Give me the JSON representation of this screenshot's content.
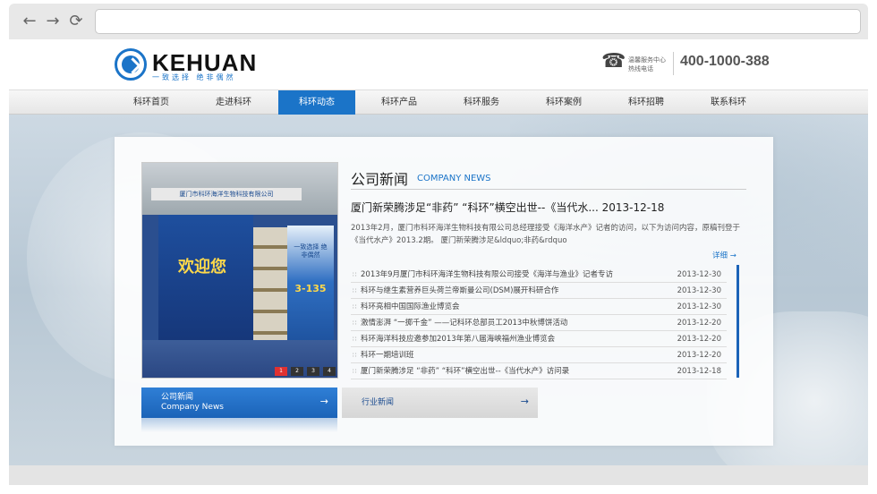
{
  "colors": {
    "brand": "#1b74c8",
    "active_nav": "#1b74c8",
    "accent_red": "#e03131"
  },
  "browser": {
    "back_icon": "arrow-left-icon",
    "forward_icon": "arrow-right-icon",
    "reload_icon": "reload-icon",
    "back_glyph": "←",
    "forward_glyph": "→",
    "reload_glyph": "⟳",
    "address": ""
  },
  "header": {
    "logo_text": "KEHUAN",
    "logo_slogan": "一致选择 绝非偶然",
    "phone_glyph": "☎",
    "hotline_label_1": "温馨服务中心",
    "hotline_label_2": "热线电话",
    "hotline_number": "400-1000-388"
  },
  "nav": {
    "items": [
      {
        "label": "科环首页"
      },
      {
        "label": "走进科环"
      },
      {
        "label": "科环动态"
      },
      {
        "label": "科环产品"
      },
      {
        "label": "科环服务"
      },
      {
        "label": "科环案例"
      },
      {
        "label": "科环招聘"
      },
      {
        "label": "联系科环"
      }
    ],
    "active_index": 2
  },
  "slideshow": {
    "banner_text": "厦门市科环海洋生物科技有限公司",
    "welcome_text": "欢迎您",
    "standee_text": "一致选择 绝非偶然",
    "standee_number": "3-135",
    "dots": [
      "1",
      "2",
      "3",
      "4"
    ],
    "active_dot": 0
  },
  "tabs": {
    "company": {
      "label_cn": "公司新闻",
      "label_en": "Company News",
      "arrow": "→"
    },
    "industry": {
      "label_cn": "行业新闻",
      "arrow": "→"
    }
  },
  "news": {
    "heading": "公司新闻",
    "heading_en": "COMPANY NEWS",
    "headline": "厦门新荣腾涉足“非药” “科环”横空出世--《当代水... 2013-12-18",
    "summary": "2013年2月，厦门市科环海洋生物科技有限公司总经理接受《海洋水产》记者的访问，以下为访问内容，原稿刊登于《当代水产》2013.2期。 厦门新荣腾涉足&ldquo;非药&rdquo",
    "more_label": "详细 →",
    "bullet": "∷",
    "items": [
      {
        "title": "2013年9月厦门市科环海洋生物科技有限公司接受《海洋与渔业》记者专访",
        "date": "2013-12-30"
      },
      {
        "title": "科环与继生素营养巨头荷兰帝斯曼公司(DSM)展开科研合作",
        "date": "2013-12-30"
      },
      {
        "title": "科环亮相中国国际渔业博览会",
        "date": "2013-12-30"
      },
      {
        "title": "激情澎湃 “一掷千金” ——记科环总部员工2013中秋博饼活动",
        "date": "2013-12-20"
      },
      {
        "title": "科环海洋科技应邀参加2013年第八届海峡福州渔业博览会",
        "date": "2013-12-20"
      },
      {
        "title": "科环一期培训班",
        "date": "2013-12-20"
      },
      {
        "title": "厦门新荣腾涉足 “非药” “科环”横空出世--《当代水产》访问录",
        "date": "2013-12-18"
      }
    ]
  }
}
